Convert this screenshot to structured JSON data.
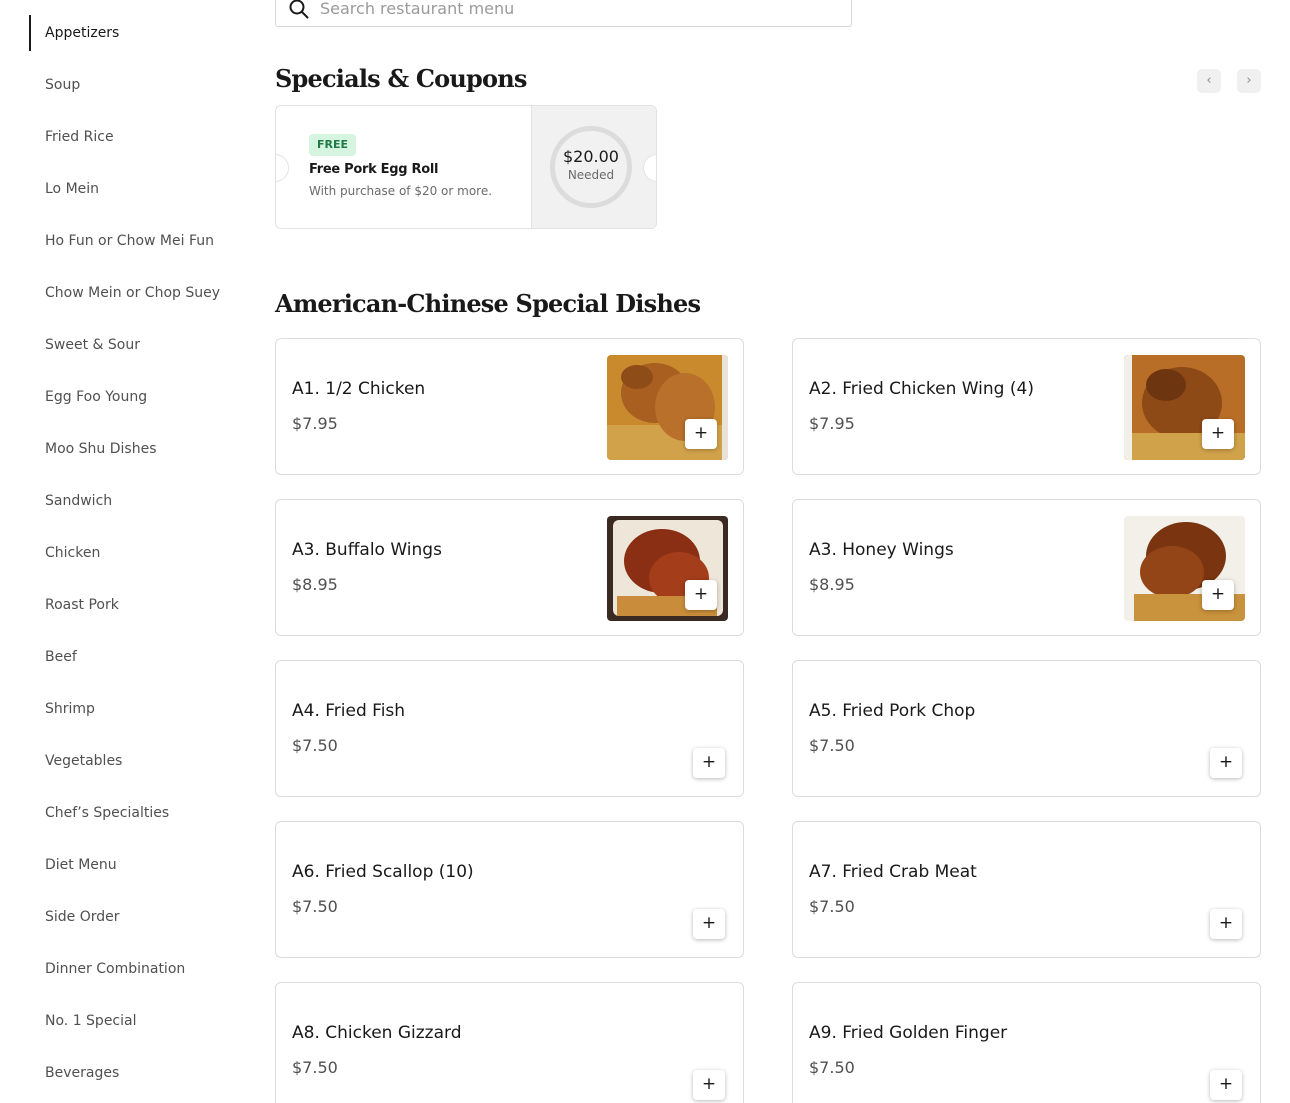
{
  "sidebar": {
    "items": [
      {
        "label": "Appetizers",
        "active": true
      },
      {
        "label": "Soup"
      },
      {
        "label": "Fried Rice"
      },
      {
        "label": "Lo Mein"
      },
      {
        "label": "Ho Fun or Chow Mei Fun"
      },
      {
        "label": "Chow Mein or Chop Suey"
      },
      {
        "label": "Sweet & Sour"
      },
      {
        "label": "Egg Foo Young"
      },
      {
        "label": "Moo Shu Dishes"
      },
      {
        "label": "Sandwich"
      },
      {
        "label": "Chicken"
      },
      {
        "label": "Roast Pork"
      },
      {
        "label": "Beef"
      },
      {
        "label": "Shrimp"
      },
      {
        "label": "Vegetables"
      },
      {
        "label": "Chef’s Specialties"
      },
      {
        "label": "Diet Menu"
      },
      {
        "label": "Side Order"
      },
      {
        "label": "Dinner Combination"
      },
      {
        "label": "No. 1 Special"
      },
      {
        "label": "Beverages"
      }
    ]
  },
  "search": {
    "placeholder": "Search restaurant menu",
    "icon": "search-icon"
  },
  "specials": {
    "title": "Specials & Coupons",
    "prev_icon": "‹",
    "next_icon": "›",
    "coupon": {
      "badge": "FREE",
      "title": "Free Pork Egg Roll",
      "description": "With purchase of $20 or more.",
      "amount": "$20.00",
      "amount_label": "Needed"
    }
  },
  "section": {
    "title": "American-Chinese Special Dishes",
    "add_symbol": "+",
    "items": [
      {
        "name": "A1. 1/2 Chicken",
        "price": "$7.95",
        "has_photo": true
      },
      {
        "name": "A2. Fried Chicken Wing (4)",
        "price": "$7.95",
        "has_photo": true
      },
      {
        "name": "A3. Buffalo Wings",
        "price": "$8.95",
        "has_photo": true
      },
      {
        "name": "A3. Honey Wings",
        "price": "$8.95",
        "has_photo": true
      },
      {
        "name": "A4. Fried Fish",
        "price": "$7.50",
        "has_photo": false
      },
      {
        "name": "A5. Fried Pork Chop",
        "price": "$7.50",
        "has_photo": false
      },
      {
        "name": "A6. Fried Scallop (10)",
        "price": "$7.50",
        "has_photo": false
      },
      {
        "name": "A7. Fried Crab Meat",
        "price": "$7.50",
        "has_photo": false
      },
      {
        "name": "A8. Chicken Gizzard",
        "price": "$7.50",
        "has_photo": false
      },
      {
        "name": "A9. Fried Golden Finger",
        "price": "$7.50",
        "has_photo": false
      }
    ]
  },
  "colors": {
    "text": "#191919",
    "muted": "#505050",
    "badge_bg": "#d6f5e0",
    "badge_text": "#1f7a43",
    "border": "#dcdcdc"
  }
}
